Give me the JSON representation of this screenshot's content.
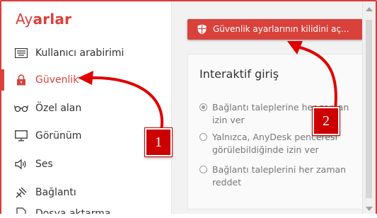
{
  "sidebar": {
    "title_prefix": "Ay",
    "title_suffix": "arlar",
    "items": [
      {
        "label": "Kullanıcı arabirimi",
        "icon": "keyboard-icon"
      },
      {
        "label": "Güvenlik",
        "icon": "lock-icon",
        "active": true
      },
      {
        "label": "Özel alan",
        "icon": "glasses-icon"
      },
      {
        "label": "Görünüm",
        "icon": "monitor-icon"
      },
      {
        "label": "Ses",
        "icon": "speaker-icon"
      },
      {
        "label": "Bağlantı",
        "icon": "connection-icon"
      },
      {
        "label": "Dosya aktarma",
        "icon": "file-transfer-icon"
      }
    ]
  },
  "main": {
    "unlock_button": {
      "label": "Güvenlik ayarlarının kilidini aç...",
      "icon": "shield-icon"
    },
    "interactive_access": {
      "title": "Interaktif giriş",
      "options": [
        {
          "label": "Bağlantı taleplerine her zaman izin ver",
          "checked": true
        },
        {
          "label": "Yalnızca, AnyDesk penceresi görülebildiğinde izin ver",
          "checked": false
        },
        {
          "label": "Bağlantı taleplerini her zaman reddet",
          "checked": false
        }
      ]
    }
  },
  "annotations": {
    "badge_1": "1",
    "badge_2": "2"
  },
  "colors": {
    "accent": "#d9413b",
    "annotation_red": "#cc0000"
  }
}
